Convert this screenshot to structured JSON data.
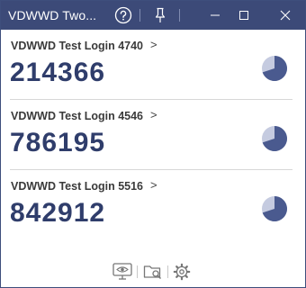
{
  "window": {
    "title": "VDWWD Two..."
  },
  "entries": [
    {
      "name": "VDWWD Test Login 4740",
      "chevron": ">",
      "code": "214366",
      "remaining_fraction": 0.3
    },
    {
      "name": "VDWWD Test Login 4546",
      "chevron": ">",
      "code": "786195",
      "remaining_fraction": 0.3
    },
    {
      "name": "VDWWD Test Login 5516",
      "chevron": ">",
      "code": "842912",
      "remaining_fraction": 0.3
    }
  ],
  "icons": {
    "help": "help-circle-icon",
    "pin": "pin-icon",
    "minimize": "minimize-icon",
    "maximize": "maximize-icon",
    "close": "close-icon",
    "show": "monitor-eye-icon",
    "search": "folder-search-icon",
    "settings": "gear-icon"
  },
  "colors": {
    "titlebar": "#3c4a78",
    "code": "#2f3d6b",
    "timer_fill": "#4a5a8f",
    "timer_empty": "#c5cbe0"
  }
}
